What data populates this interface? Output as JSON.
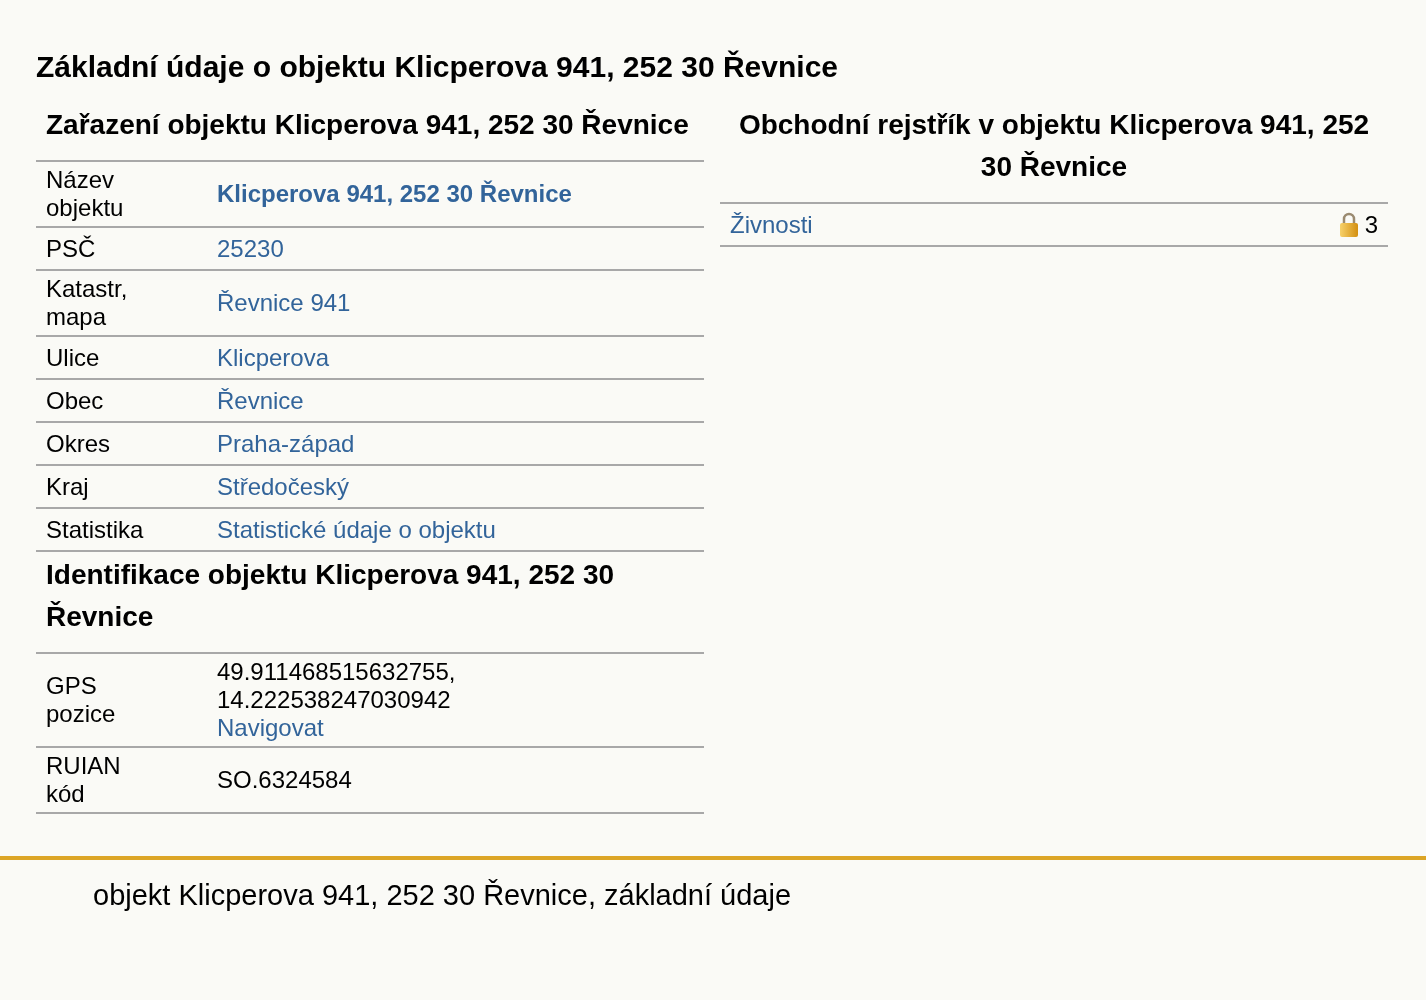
{
  "title": "Základní údaje o objektu Klicperova 941, 252 30 Řevnice",
  "left": [
    {
      "heading": "Zařazení objektu Klicperova 941, 252 30 Řevnice",
      "rows": [
        {
          "label": "Název objektu",
          "values": [
            {
              "kind": "bold-link",
              "text": "Klicperova 941, 252 30 Řevnice"
            }
          ]
        },
        {
          "label": "PSČ",
          "values": [
            {
              "kind": "link",
              "text": "25230"
            }
          ]
        },
        {
          "label": "Katastr, mapa",
          "values": [
            {
              "kind": "link",
              "text": "Řevnice 941"
            }
          ]
        },
        {
          "label": "Ulice",
          "values": [
            {
              "kind": "link",
              "text": "Klicperova"
            }
          ]
        },
        {
          "label": "Obec",
          "values": [
            {
              "kind": "link",
              "text": "Řevnice"
            }
          ]
        },
        {
          "label": "Okres",
          "values": [
            {
              "kind": "link",
              "text": "Praha-západ"
            }
          ]
        },
        {
          "label": "Kraj",
          "values": [
            {
              "kind": "link",
              "text": "Středočeský"
            }
          ]
        },
        {
          "label": "Statistika",
          "values": [
            {
              "kind": "link",
              "text": "Statistické údaje o objektu"
            }
          ]
        }
      ]
    },
    {
      "heading": "Identifikace objektu Klicperova 941, 252 30 Řevnice",
      "rows": [
        {
          "label": "GPS pozice",
          "values": [
            {
              "kind": "text",
              "text": "49.911468515632755,"
            },
            {
              "kind": "text",
              "text": "14.222538247030942"
            },
            {
              "kind": "link",
              "text": "Navigovat"
            }
          ]
        },
        {
          "label": "RUIAN kód",
          "values": [
            {
              "kind": "text",
              "text": "SO.6324584"
            }
          ]
        }
      ]
    }
  ],
  "right": {
    "heading": "Obchodní rejstřík v objektu Klicperova 941, 252 30 Řevnice",
    "rows": [
      {
        "label": "Živnosti",
        "locked": true,
        "count": "3"
      }
    ]
  },
  "footer": "objekt Klicperova 941, 252 30 Řevnice, základní údaje"
}
